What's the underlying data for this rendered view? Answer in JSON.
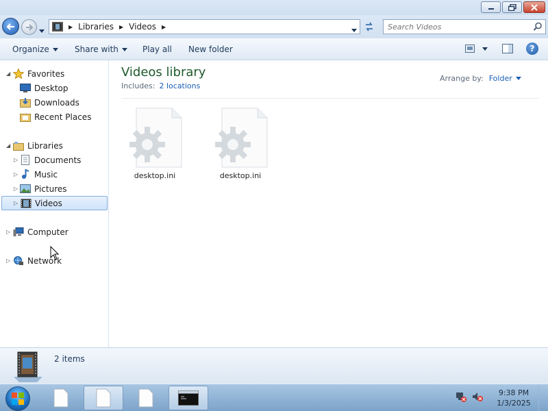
{
  "window": {
    "address": {
      "crumbs": [
        "Libraries",
        "Videos"
      ]
    },
    "search": {
      "placeholder": "Search Videos"
    }
  },
  "toolbar": {
    "organize": "Organize",
    "share_with": "Share with",
    "play_all": "Play all",
    "new_folder": "New folder",
    "help": "?"
  },
  "nav": {
    "favorites": {
      "label": "Favorites",
      "items": [
        "Desktop",
        "Downloads",
        "Recent Places"
      ]
    },
    "libraries": {
      "label": "Libraries",
      "items": [
        "Documents",
        "Music",
        "Pictures",
        "Videos"
      ]
    },
    "computer": "Computer",
    "network": "Network",
    "selected": "Videos"
  },
  "content": {
    "title": "Videos library",
    "includes_label": "Includes:",
    "includes_link": "2 locations",
    "arrange_label": "Arrange by:",
    "arrange_value": "Folder",
    "files": [
      {
        "name": "desktop.ini",
        "icon": "settings-file-icon"
      },
      {
        "name": "desktop.ini",
        "icon": "settings-file-icon"
      }
    ]
  },
  "details": {
    "count": "2 items"
  },
  "taskbar": {
    "clock_time": "9:38 PM",
    "clock_date": "1/3/2025"
  },
  "colors": {
    "title_green": "#1e5a2b",
    "link_blue": "#1a5eb4",
    "selection": "#cfe4fb"
  }
}
